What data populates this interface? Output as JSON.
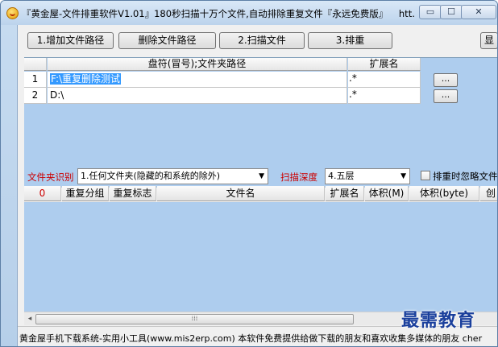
{
  "window": {
    "title": "『黄金屋-文件排重软件V1.01』180秒扫描十万个文件,自动排除重复文件『永远免费版』",
    "title_extra": "htt..."
  },
  "toolbar": {
    "add_path": "1.增加文件路径",
    "delete_path": "删除文件路径",
    "scan": "2.扫描文件",
    "dedupe": "3.排重",
    "more": "显"
  },
  "paths_table": {
    "headers": {
      "path": "盘符(冒号);文件夹路径",
      "ext": "扩展名"
    },
    "rows": [
      {
        "num": "1",
        "path": "F:\\重复删除测试",
        "ext": ".*",
        "browse": "..."
      },
      {
        "num": "2",
        "path": "D:\\",
        "ext": ".*",
        "browse": "..."
      }
    ]
  },
  "options": {
    "folder_label": "文件夹识别",
    "folder_value": "1.任何文件夹(隐藏的和系统的除外)",
    "depth_label": "扫描深度",
    "depth_value": "4.五层",
    "ignore_label": "排重时忽略文件"
  },
  "results_table": {
    "headers": {
      "count": "0",
      "group": "重复分组",
      "flag": "重复标志",
      "name": "文件名",
      "ext": "扩展名",
      "size_m": "体积(M)",
      "size_b": "体积(byte)",
      "more": "创"
    }
  },
  "status": {
    "text": "黄金屋手机下载系统-实用小工具(www.mis2erp.com)   本软件免费提供给做下载的朋友和喜欢收集多媒体的朋友  cher"
  },
  "watermark": "最需教育",
  "colors": {
    "accent_red": "#cc0000",
    "list_background": "#aecdee",
    "selection": "#3399ff"
  }
}
